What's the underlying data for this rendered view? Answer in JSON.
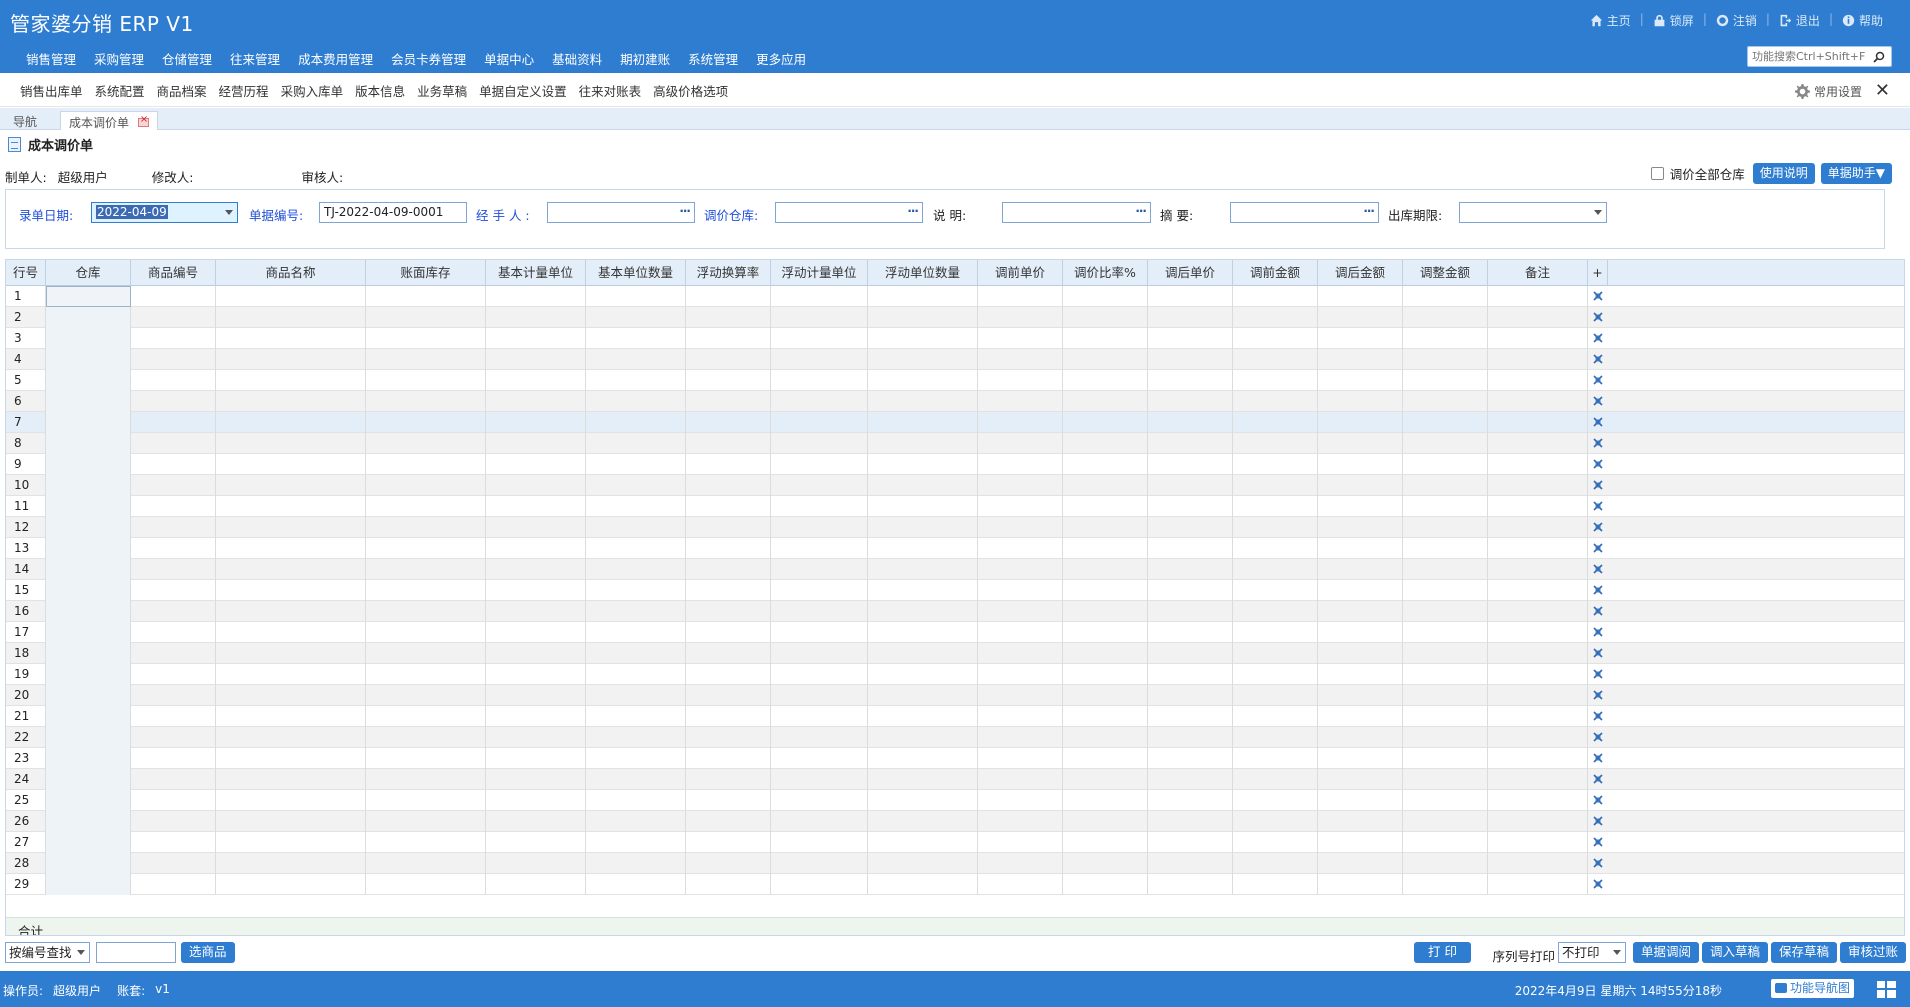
{
  "app": {
    "title": "管家婆分销 ERP V1"
  },
  "top_links": [
    {
      "label": "主页",
      "icon": "home-icon"
    },
    {
      "label": "锁屏",
      "icon": "lock-icon"
    },
    {
      "label": "注销",
      "icon": "power-icon"
    },
    {
      "label": "退出",
      "icon": "exit-icon"
    },
    {
      "label": "帮助",
      "icon": "info-icon"
    }
  ],
  "main_menu": [
    "销售管理",
    "采购管理",
    "仓储管理",
    "往来管理",
    "成本费用管理",
    "会员卡券管理",
    "单据中心",
    "基础资料",
    "期初建账",
    "系统管理",
    "更多应用"
  ],
  "function_search": {
    "placeholder": "功能搜索Ctrl+Shift+F"
  },
  "quick_menu": [
    "销售出库单",
    "系统配置",
    "商品档案",
    "经营历程",
    "采购入库单",
    "版本信息",
    "业务草稿",
    "单据自定义设置",
    "往来对账表",
    "高级价格选项"
  ],
  "common_settings": "常用设置",
  "tabs": [
    {
      "label": "导航"
    },
    {
      "label": "成本调价单"
    }
  ],
  "document": {
    "title": "成本调价单",
    "creator_label": "制单人:",
    "creator": "超级用户",
    "modifier_label": "修改人:",
    "modifier": "",
    "auditor_label": "审核人:",
    "auditor": "",
    "all_warehouse_label": "调价全部仓库",
    "help_button": "使用说明",
    "assistant_button": "单据助手▼"
  },
  "form": {
    "date_label": "录单日期:",
    "date_value": "2022-04-09",
    "number_label": "单据编号:",
    "number_value": "TJ-2022-04-09-0001",
    "handler_label": "经 手 人 :",
    "warehouse_label": "调价仓库:",
    "note_label": "说      明:",
    "summary_label": "摘      要:",
    "expiry_label": "出库期限:"
  },
  "grid": {
    "columns": [
      "行号",
      "仓库",
      "商品编号",
      "商品名称",
      "账面库存",
      "基本计量单位",
      "基本单位数量",
      "浮动换算率",
      "浮动计量单位",
      "浮动单位数量",
      "调前单价",
      "调价比率%",
      "调后单价",
      "调前金额",
      "调后金额",
      "调整金额",
      "备注",
      "+"
    ],
    "rows": [
      "1",
      "2",
      "3",
      "4",
      "5",
      "6",
      "7",
      "8",
      "9",
      "10",
      "11",
      "12",
      "13",
      "14",
      "15",
      "16",
      "17",
      "18",
      "19",
      "20",
      "21",
      "22",
      "23",
      "24",
      "25",
      "26",
      "27",
      "28",
      "29"
    ],
    "total_label": "合计"
  },
  "bottom": {
    "search_mode": "按编号查找",
    "select_goods": "选商品",
    "print": "打 印",
    "serial_print_label": "序列号打印",
    "serial_print_value": "不打印",
    "buttons": [
      "单据调阅",
      "调入草稿",
      "保存草稿",
      "审核过账"
    ]
  },
  "status": {
    "operator_label": "操作员:",
    "operator": "超级用户",
    "account_label": "账套:",
    "account": "v1",
    "datetime": "2022年4月9日  星期六  14时55分18秒",
    "nav_map": "功能导航图"
  },
  "colors": {
    "primary": "#2e7dd1",
    "header_bg": "#e4eef9",
    "label_blue": "#1f4fd8",
    "selected_row": "#e4eef9"
  }
}
